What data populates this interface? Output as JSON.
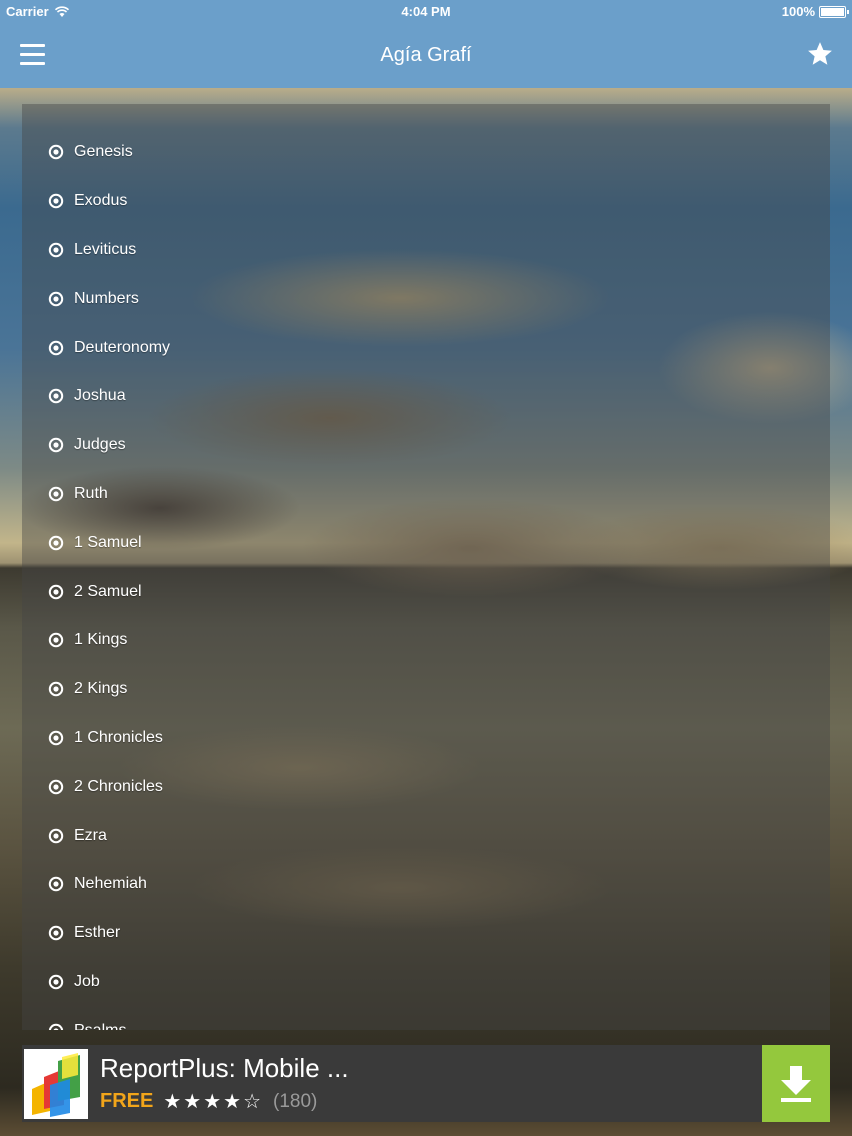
{
  "status_bar": {
    "carrier": "Carrier",
    "time": "4:04 PM",
    "battery": "100%"
  },
  "nav": {
    "title": "Agía Grafí",
    "menu_icon": "hamburger-menu-icon",
    "favorite_icon": "star-icon"
  },
  "books": [
    {
      "name": "Genesis"
    },
    {
      "name": "Exodus"
    },
    {
      "name": "Leviticus"
    },
    {
      "name": "Numbers"
    },
    {
      "name": "Deuteronomy"
    },
    {
      "name": "Joshua"
    },
    {
      "name": "Judges"
    },
    {
      "name": "Ruth"
    },
    {
      "name": "1 Samuel"
    },
    {
      "name": "2 Samuel"
    },
    {
      "name": "1 Kings"
    },
    {
      "name": "2 Kings"
    },
    {
      "name": "1 Chronicles"
    },
    {
      "name": "2 Chronicles"
    },
    {
      "name": "Ezra"
    },
    {
      "name": "Nehemiah"
    },
    {
      "name": "Esther"
    },
    {
      "name": "Job"
    },
    {
      "name": "Psalms"
    }
  ],
  "ad": {
    "title": "ReportPlus: Mobile ...",
    "price": "FREE",
    "stars": "★★★★☆",
    "rating": 4.5,
    "review_count": "(180)",
    "download_icon": "download-arrow-icon"
  },
  "colors": {
    "nav_bar": "#6b9fca",
    "ad_free": "#f2a51a",
    "ad_download": "#94c83d"
  }
}
